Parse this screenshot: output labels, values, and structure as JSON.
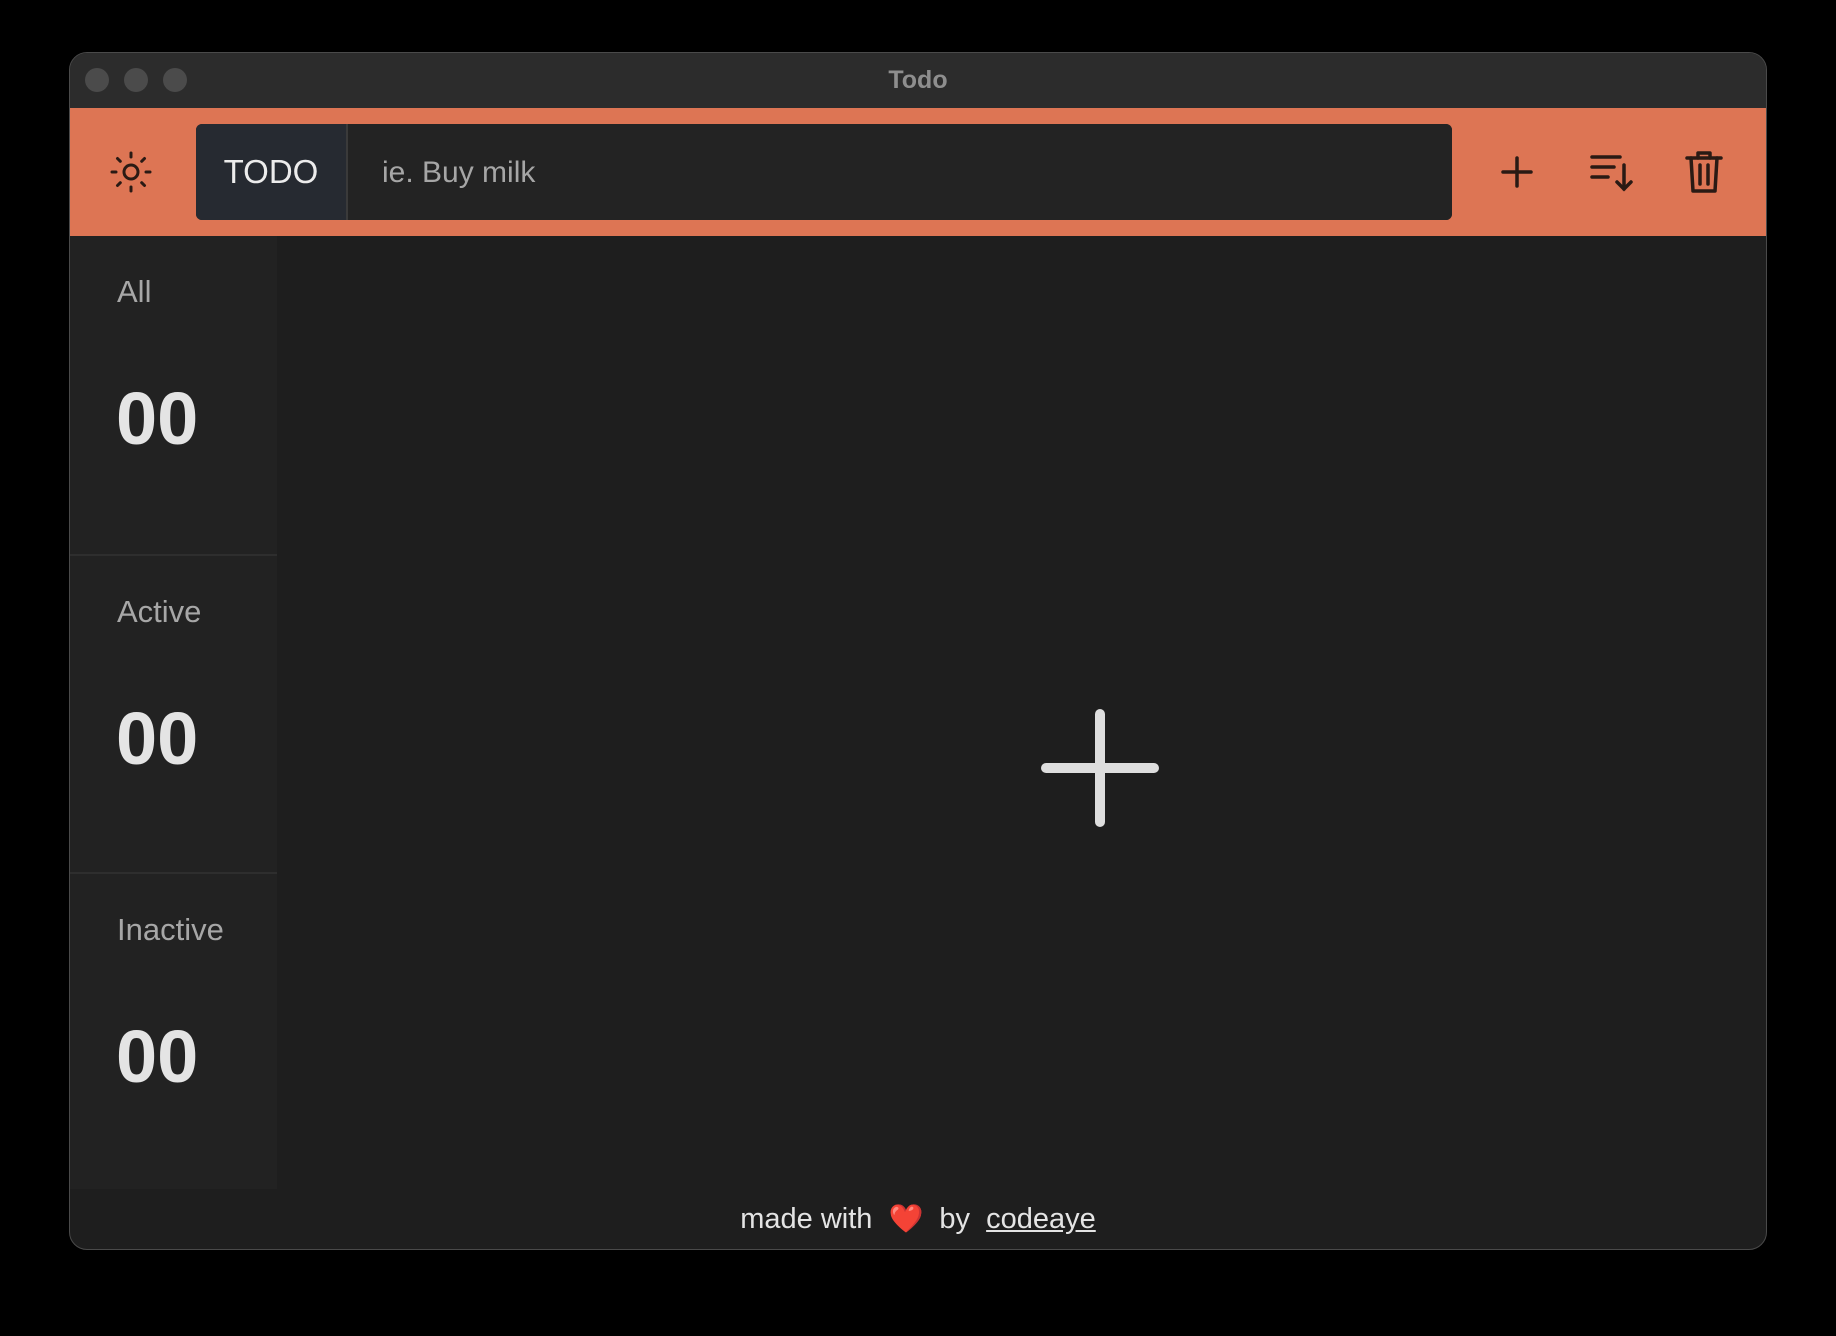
{
  "window": {
    "title": "Todo"
  },
  "toolbar": {
    "theme_icon": "sun-icon",
    "input_label": "TODO",
    "input_placeholder": "ie. Buy milk",
    "input_value": "",
    "add_icon": "plus-icon",
    "sort_icon": "sort-descending-icon",
    "delete_icon": "trash-icon",
    "accent_color": "#dd7554"
  },
  "sidebar": {
    "stats": [
      {
        "label": "All",
        "count": "00"
      },
      {
        "label": "Active",
        "count": "00"
      },
      {
        "label": "Inactive",
        "count": "00"
      }
    ]
  },
  "main": {
    "empty_icon": "plus-icon"
  },
  "footer": {
    "prefix": "made with",
    "heart": "❤️",
    "by": "by",
    "author": "codeaye"
  }
}
